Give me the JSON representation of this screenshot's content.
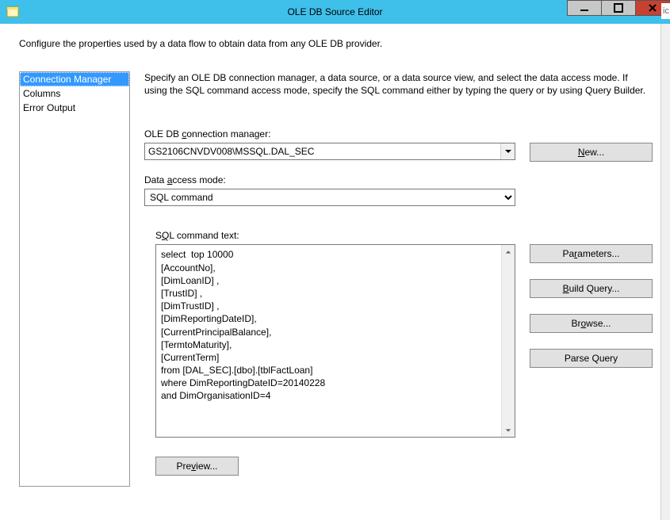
{
  "window": {
    "title": "OLE DB Source Editor"
  },
  "intro": "Configure the properties used by a data flow to obtain data from any OLE DB provider.",
  "nav": {
    "items": [
      {
        "label": "Connection Manager",
        "selected": true
      },
      {
        "label": "Columns",
        "selected": false
      },
      {
        "label": "Error Output",
        "selected": false
      }
    ]
  },
  "main": {
    "description": "Specify an OLE DB connection manager, a data source, or a data source view, and select the data access mode. If using the SQL command access mode, specify the SQL command either by typing the query or by using Query Builder.",
    "conn_label_pre": "OLE DB ",
    "conn_label_u": "c",
    "conn_label_post": "onnection manager:",
    "conn_value": "GS2106CNVDV008\\MSSQL.DAL_SEC",
    "mode_label_pre": "Data ",
    "mode_label_u": "a",
    "mode_label_post": "ccess mode:",
    "mode_value": "SQL command",
    "sql_label_pre": "S",
    "sql_label_u": "Q",
    "sql_label_post": "L command text:",
    "sql_text": "select  top 10000\n[AccountNo],\n[DimLoanID] ,\n[TrustID] ,\n[DimTrustID] ,\n[DimReportingDateID],\n[CurrentPrincipalBalance],\n[TermtoMaturity],\n[CurrentTerm]\nfrom [DAL_SEC].[dbo].[tblFactLoan]\nwhere DimReportingDateID=20140228\nand DimOrganisationID=4"
  },
  "buttons": {
    "new_u": "N",
    "new_post": "ew...",
    "parameters": "Pa",
    "parameters_u": "r",
    "parameters_post": "ameters...",
    "build_u": "B",
    "build_post": "uild Query...",
    "browse_pre": "Br",
    "browse_u": "o",
    "browse_post": "wse...",
    "parse": "Parse Query",
    "preview_pre": "Pre",
    "preview_u": "v",
    "preview_post": "iew..."
  }
}
